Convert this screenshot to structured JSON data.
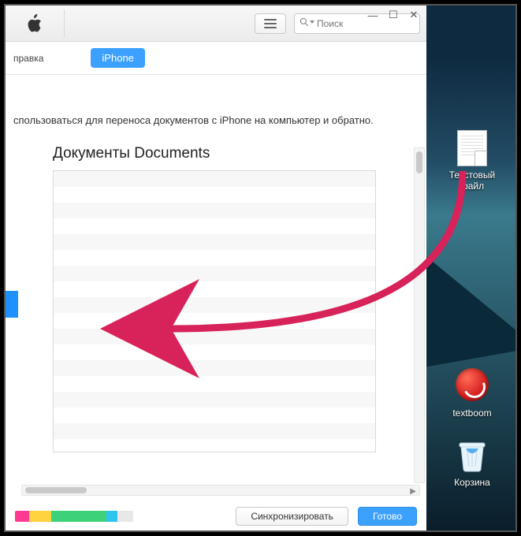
{
  "titlebar": {
    "search_placeholder": "Поиск"
  },
  "devicebar": {
    "help": "правка",
    "device_pill": "iPhone"
  },
  "content": {
    "description": "спользоваться для переноса документов с iPhone на компьютер и обратно.",
    "documents_title": "Документы Documents"
  },
  "footer": {
    "sync_label": "Синхронизировать",
    "done_label": "Готово"
  },
  "desktop": {
    "file_label": "Текстовый файл",
    "textboom_label": "textboom",
    "trash_label": "Корзина"
  }
}
